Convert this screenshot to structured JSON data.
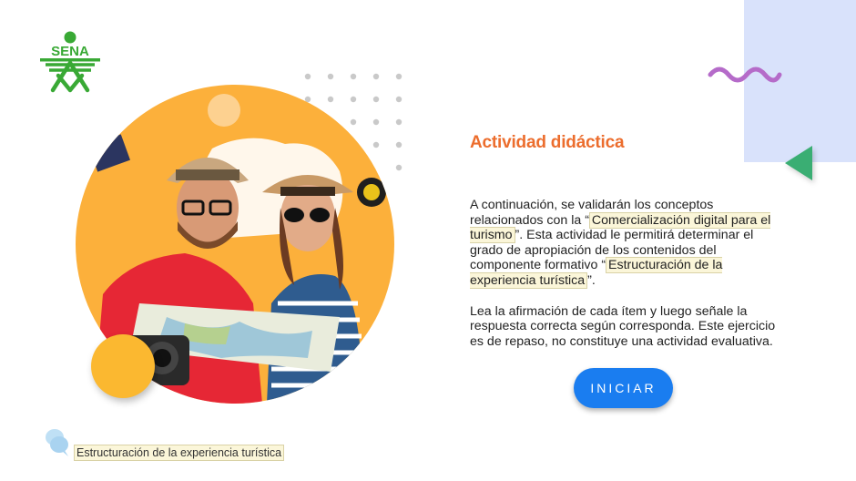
{
  "brand": {
    "logo_text": "SENA",
    "logo_color": "#39a935"
  },
  "activity": {
    "title": "Actividad didáctica",
    "paragraph1": {
      "part1": "A continuación, se validarán los conceptos relacionados con la “",
      "highlight1": "Comercialización digital para el turismo",
      "part2": "”. Esta actividad le permitirá determinar el grado de apropiación de los contenidos del componente formativo “",
      "highlight2": "Estructuración de la experiencia turística",
      "part3": "”."
    },
    "paragraph2": "Lea la afirmación de cada ítem y luego señale la respuesta correcta según corresponda. Este ejercicio es de repaso, no constituye una actividad evaluativa.",
    "start_label": "INICIAR"
  },
  "footer": {
    "label": "Estructuración de la experiencia turística"
  },
  "colors": {
    "title": "#ec6d2d",
    "button": "#1a7df0",
    "hero": "#fcb03b",
    "accent_purple": "#b56bc9",
    "accent_green": "#3aae73",
    "panel": "#d9e2fb"
  },
  "icons": {
    "logo": "sena-logo-icon",
    "squiggle": "wave-decoration-icon",
    "triangle": "triangle-decoration-icon",
    "footer": "speech-bubble-icon"
  }
}
